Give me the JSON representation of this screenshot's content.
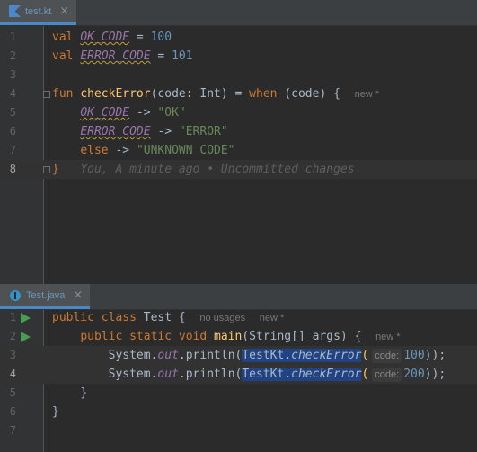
{
  "top_tab": {
    "label": "test.kt",
    "close": "×",
    "icon": "kotlin-file-icon"
  },
  "bottom_tab": {
    "label": "Test.java",
    "close": "×",
    "icon": "java-class-icon"
  },
  "kotlin": {
    "line_numbers": [
      "1",
      "2",
      "3",
      "4",
      "5",
      "6",
      "7",
      "8"
    ],
    "l1": {
      "kw": "val",
      "name": "OK_CODE",
      "eq": " = ",
      "val": "100"
    },
    "l2": {
      "kw": "val",
      "name": "ERROR_CODE",
      "eq": " = ",
      "val": "101"
    },
    "l4": {
      "kw": "fun",
      "fname": "checkError",
      "params": "(code: Int) = ",
      "when": "when",
      "rest": " (code) {",
      "hint": "new *"
    },
    "l5": {
      "name": "OK_CODE",
      "arrow": " -> ",
      "str": "\"OK\""
    },
    "l6": {
      "name": "ERROR_CODE",
      "arrow": " -> ",
      "str": "\"ERROR\""
    },
    "l7": {
      "kw": "else",
      "arrow": " -> ",
      "str": "\"UNKNOWN CODE\""
    },
    "l8": {
      "brace": "}",
      "blame": "You, A minute ago • Uncommitted changes"
    }
  },
  "java": {
    "line_numbers": [
      "1",
      "2",
      "3",
      "4",
      "5",
      "6",
      "7"
    ],
    "l1": {
      "kw": "public class",
      "name": " Test {",
      "hint1": "no usages",
      "hint2": "new *"
    },
    "l2": {
      "kw": "public static void",
      "fname": "main",
      "rest": "(String[] args) {",
      "hint": "new *"
    },
    "l3": {
      "pre": "System.",
      "out": "out",
      "mid": ".println(",
      "sel": "TestKt.checkError",
      "paren": "(",
      "inlay": "code:",
      "val": "100",
      "end": "));"
    },
    "l4": {
      "pre": "System.",
      "out": "out",
      "mid": ".println(",
      "sel": "TestKt.checkError",
      "paren": "(",
      "inlay": "code:",
      "val": "200",
      "end": "));"
    },
    "l5": {
      "brace": "}"
    },
    "l6": {
      "brace": "}"
    }
  }
}
